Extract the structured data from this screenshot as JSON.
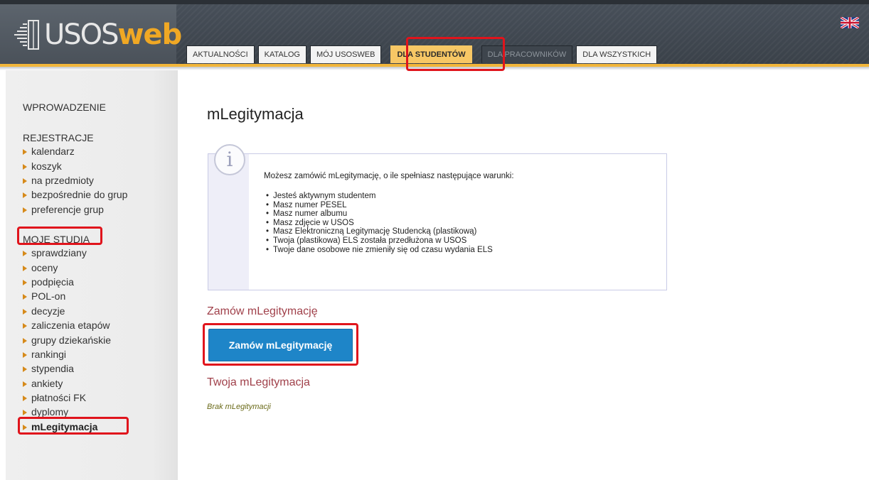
{
  "header": {
    "logo_usos": "USOS",
    "logo_web": "web",
    "language_flag": "uk-flag-icon",
    "tabs": [
      {
        "label": "AKTUALNOŚCI"
      },
      {
        "label": "KATALOG"
      },
      {
        "label": "MÓJ USOSWEB"
      },
      {
        "label": "DLA STUDENTÓW"
      },
      {
        "label": "DLA PRACOWNIKÓW"
      },
      {
        "label": "DLA WSZYSTKICH"
      }
    ]
  },
  "sidebar": {
    "intro": "WPROWADZENIE",
    "registrations": {
      "title": "REJESTRACJE",
      "items": [
        "kalendarz",
        "koszyk",
        "na przedmioty",
        "bezpośrednie do grup",
        "preferencje grup"
      ]
    },
    "my_studies": {
      "title": "MOJE STUDIA",
      "items": [
        "sprawdziany",
        "oceny",
        "podpięcia",
        "POL-on",
        "decyzje",
        "zaliczenia etapów",
        "grupy dziekańskie",
        "rankingi",
        "stypendia",
        "ankiety",
        "płatności FK",
        "dyplomy",
        "mLegitymacja"
      ]
    }
  },
  "main": {
    "title": "mLegitymacja",
    "info": {
      "icon": "info-icon",
      "intro": "Możesz zamówić mLegitymację, o ile spełniasz następujące warunki:",
      "conditions": [
        "Jesteś aktywnym studentem",
        "Masz numer PESEL",
        "Masz numer albumu",
        "Masz zdjęcie w USOS",
        "Masz Elektroniczną Legitymację Studencką (plastikową)",
        "Twoja (plastikowa) ELS została przedłużona w USOS",
        "Twoje dane osobowe nie zmieniły się od czasu wydania ELS"
      ]
    },
    "order_heading": "Zamów mLegitymację",
    "order_button": "Zamów mLegitymację",
    "your_heading": "Twoja mLegitymacja",
    "empty_note": "Brak mLegitymacji"
  },
  "colors": {
    "tab_active": "#f7c765",
    "button": "#1e85c8",
    "section_heading": "#a0404a",
    "highlight": "#e0141c"
  }
}
